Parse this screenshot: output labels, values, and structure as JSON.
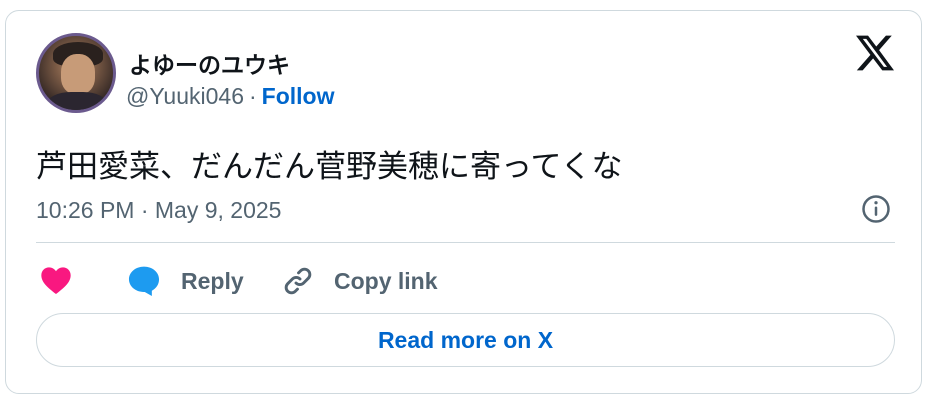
{
  "author": {
    "display_name": "よゆーのユウキ",
    "handle": "@Yuuki046",
    "separator": "·",
    "follow_label": "Follow"
  },
  "tweet": {
    "text": "芦田愛菜、だんだん菅野美穂に寄ってくな",
    "timestamp": "10:26 PM · May 9, 2025"
  },
  "actions": {
    "reply_label": "Reply",
    "copy_link_label": "Copy link",
    "read_more_label": "Read more on X"
  },
  "icons": {
    "brand": "x-logo-icon",
    "info": "info-icon",
    "like": "heart-icon",
    "reply": "speech-bubble-icon",
    "copy": "link-icon"
  },
  "colors": {
    "link_blue": "#0066cc",
    "heart_pink": "#f91880",
    "reply_blue": "#1d9bf0",
    "secondary_text": "#536471",
    "primary_text": "#0f1419",
    "border": "#cfd9de"
  }
}
